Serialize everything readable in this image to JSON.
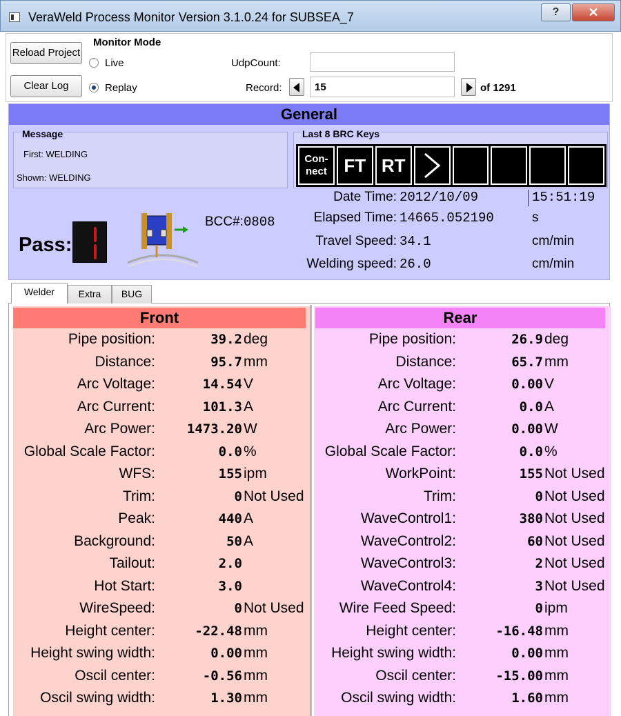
{
  "window": {
    "title": "VeraWeld Process Monitor Version 3.1.0.24 for SUBSEA_7",
    "help_glyph": "?",
    "close_glyph": "✕"
  },
  "toolbar": {
    "reload_label": "Reload Project",
    "clear_label": "Clear Log",
    "monitor_mode_label": "Monitor Mode",
    "live_label": "Live",
    "replay_label": "Replay",
    "selected_mode": "Replay",
    "udp_label": "UdpCount:",
    "udp_value": "",
    "record_label": "Record:",
    "record_value": "15",
    "record_total": "of 1291"
  },
  "general": {
    "title": "General",
    "message_title": "Message",
    "first": "First: WELDING",
    "shown": "Shown: WELDING",
    "brc_title": "Last 8 BRC Keys",
    "brc_keys": [
      "Con-",
      "nect",
      "FT",
      "RT",
      "",
      "",
      "",
      "",
      ""
    ],
    "pass_label": "Pass:",
    "pass_value": "1",
    "bcc_label": "BCC#:",
    "bcc_value": "0808",
    "date_label": "Date Time:",
    "date_value": "2012/10/09",
    "time_value": "15:51:19",
    "elapsed_label": "Elapsed Time:",
    "elapsed_value": "14665.052190",
    "elapsed_unit": "s",
    "travel_label": "Travel Speed:",
    "travel_value": "34.1",
    "travel_unit": "cm/min",
    "welding_label": "Welding speed:",
    "welding_value": "26.0",
    "welding_unit": "cm/min"
  },
  "tabs": [
    "Welder",
    "Extra",
    "BUG"
  ],
  "front": {
    "title": "Front",
    "rows": [
      {
        "label": "Pipe position:",
        "value": "39.2",
        "unit": "deg"
      },
      {
        "label": "Distance:",
        "value": "95.7",
        "unit": "mm"
      },
      {
        "label": "Arc Voltage:",
        "value": "14.54",
        "unit": "V"
      },
      {
        "label": "Arc Current:",
        "value": "101.3",
        "unit": "A"
      },
      {
        "label": "Arc Power:",
        "value": "1473.20",
        "unit": "W"
      },
      {
        "label": "Global Scale Factor:",
        "value": "0.0",
        "unit": "%"
      },
      {
        "label": "WFS:",
        "value": "155",
        "unit": "ipm"
      },
      {
        "label": "Trim:",
        "value": "0",
        "unit": "Not Used"
      },
      {
        "label": "Peak:",
        "value": "440",
        "unit": "A"
      },
      {
        "label": "Background:",
        "value": "50",
        "unit": "A"
      },
      {
        "label": "Tailout:",
        "value": "2.0",
        "unit": ""
      },
      {
        "label": "Hot Start:",
        "value": "3.0",
        "unit": ""
      },
      {
        "label": "WireSpeed:",
        "value": "0",
        "unit": "Not Used"
      },
      {
        "label": "Height center:",
        "value": "-22.48",
        "unit": "mm"
      },
      {
        "label": "Height swing width:",
        "value": "0.00",
        "unit": "mm"
      },
      {
        "label": "Oscil center:",
        "value": "-0.56",
        "unit": "mm"
      },
      {
        "label": "Oscil swing width:",
        "value": "1.30",
        "unit": "mm"
      }
    ]
  },
  "rear": {
    "title": "Rear",
    "rows": [
      {
        "label": "Pipe position:",
        "value": "26.9",
        "unit": "deg"
      },
      {
        "label": "Distance:",
        "value": "65.7",
        "unit": "mm"
      },
      {
        "label": "Arc Voltage:",
        "value": "0.00",
        "unit": "V"
      },
      {
        "label": "Arc Current:",
        "value": "0.0",
        "unit": "A"
      },
      {
        "label": "Arc Power:",
        "value": "0.00",
        "unit": "W"
      },
      {
        "label": "Global Scale Factor:",
        "value": "0.0",
        "unit": "%"
      },
      {
        "label": "WorkPoint:",
        "value": "155",
        "unit": "Not Used"
      },
      {
        "label": "Trim:",
        "value": "0",
        "unit": "Not Used"
      },
      {
        "label": "WaveControl1:",
        "value": "380",
        "unit": "Not Used"
      },
      {
        "label": "WaveControl2:",
        "value": "60",
        "unit": "Not Used"
      },
      {
        "label": "WaveControl3:",
        "value": "2",
        "unit": "Not Used"
      },
      {
        "label": "WaveControl4:",
        "value": "3",
        "unit": "Not Used"
      },
      {
        "label": "Wire Feed Speed:",
        "value": "0",
        "unit": "ipm"
      },
      {
        "label": "Height center:",
        "value": "-16.48",
        "unit": "mm"
      },
      {
        "label": "Height swing width:",
        "value": "0.00",
        "unit": "mm"
      },
      {
        "label": "Oscil center:",
        "value": "-15.00",
        "unit": "mm"
      },
      {
        "label": "Oscil swing width:",
        "value": "1.60",
        "unit": "mm"
      }
    ]
  },
  "colors": {
    "general_bg": "#ccccff",
    "general_header": "#7b7bf5",
    "front_bg": "#ffd3cd",
    "front_header": "#ff7b74",
    "rear_bg": "#fccffc",
    "rear_header": "#f583f8",
    "pass_digit": "#c81a1a"
  }
}
